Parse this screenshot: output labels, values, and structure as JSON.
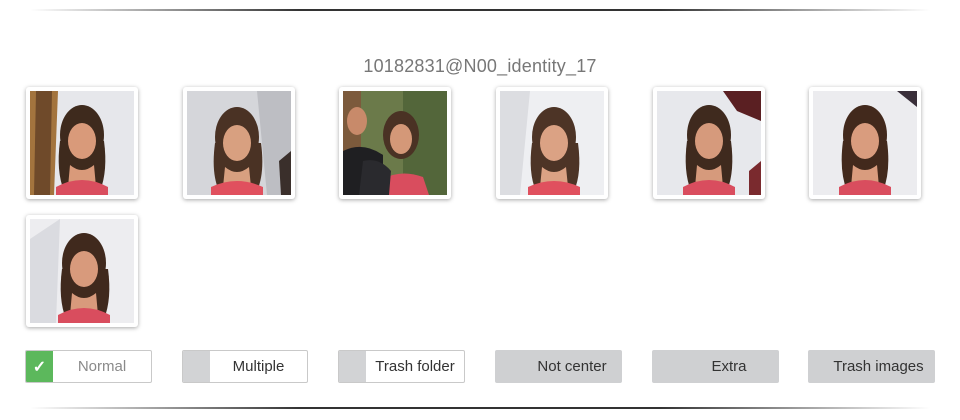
{
  "identity": {
    "title": "10182831@N00_identity_17"
  },
  "thumbnails": [
    {
      "name": "face-thumbnail-1"
    },
    {
      "name": "face-thumbnail-2"
    },
    {
      "name": "face-thumbnail-3"
    },
    {
      "name": "face-thumbnail-4"
    },
    {
      "name": "face-thumbnail-5"
    },
    {
      "name": "face-thumbnail-6"
    },
    {
      "name": "face-thumbnail-7"
    }
  ],
  "options": [
    {
      "label": "Normal",
      "checked": true,
      "check_icon": "check-icon"
    },
    {
      "label": "Multiple",
      "checked": false
    },
    {
      "label": "Trash folder",
      "checked": false
    },
    {
      "label": "Not center",
      "checked": false
    },
    {
      "label": "Extra",
      "checked": false
    },
    {
      "label": "Trash images",
      "checked": false
    }
  ],
  "colors": {
    "checked": "#5cb85c",
    "unchecked_box": "#d2d3d5",
    "title": "#777777"
  }
}
